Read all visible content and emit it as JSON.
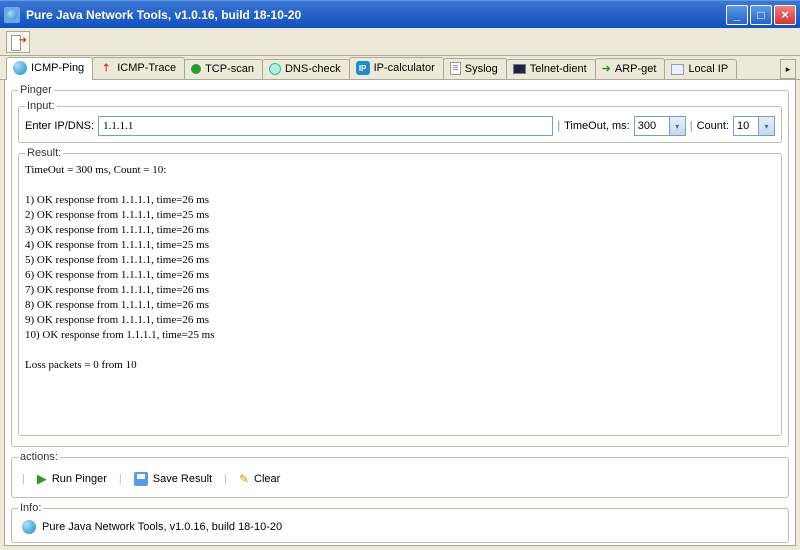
{
  "titlebar": {
    "title": "Pure Java Network Tools,  v1.0.16, build 18-10-20"
  },
  "tabs": [
    {
      "label": "ICMP-Ping",
      "icon": "globe"
    },
    {
      "label": "ICMP-Trace",
      "icon": "chart"
    },
    {
      "label": "TCP-scan",
      "icon": "green-dot"
    },
    {
      "label": "DNS-check",
      "icon": "dns"
    },
    {
      "label": "IP-calculator",
      "icon": "ip"
    },
    {
      "label": "Syslog",
      "icon": "doc"
    },
    {
      "label": "Telnet-dient",
      "icon": "screen"
    },
    {
      "label": "ARP-get",
      "icon": "arrow"
    },
    {
      "label": "Local IP",
      "icon": "monitor"
    }
  ],
  "pinger": {
    "legend": "Pinger",
    "input_legend": "Input:",
    "ip_label": "Enter IP/DNS:",
    "ip_value": "1.1.1.1",
    "timeout_label": "TimeOut, ms:",
    "timeout_value": "300",
    "count_label": "Count:",
    "count_value": "10",
    "result_legend": "Result:",
    "result_text": "TimeOut = 300 ms, Count = 10:\n\n1) OK response from 1.1.1.1, time=26 ms\n2) OK response from 1.1.1.1, time=25 ms\n3) OK response from 1.1.1.1, time=26 ms\n4) OK response from 1.1.1.1, time=25 ms\n5) OK response from 1.1.1.1, time=26 ms\n6) OK response from 1.1.1.1, time=26 ms\n7) OK response from 1.1.1.1, time=26 ms\n8) OK response from 1.1.1.1, time=26 ms\n9) OK response from 1.1.1.1, time=26 ms\n10) OK response from 1.1.1.1, time=25 ms\n\nLoss packets = 0 from 10"
  },
  "actions": {
    "legend": "actions:",
    "run": "Run Pinger",
    "save": "Save Result",
    "clear": "Clear"
  },
  "info": {
    "legend": "Info:",
    "text": "Pure Java Network Tools,  v1.0.16, build 18-10-20"
  }
}
